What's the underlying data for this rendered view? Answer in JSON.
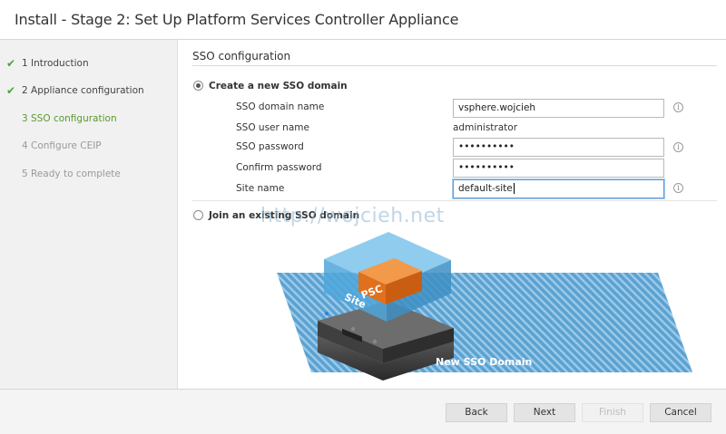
{
  "window": {
    "title": "Install - Stage 2: Set Up Platform Services Controller Appliance"
  },
  "sidebar": {
    "steps": [
      {
        "label": "1 Introduction",
        "state": "done"
      },
      {
        "label": "2 Appliance configuration",
        "state": "done"
      },
      {
        "label": "3 SSO configuration",
        "state": "current"
      },
      {
        "label": "4 Configure CEIP",
        "state": "disabled"
      },
      {
        "label": "5 Ready to complete",
        "state": "disabled"
      }
    ],
    "check_glyph": "✔"
  },
  "main": {
    "section_title": "SSO configuration",
    "options": {
      "create_label": "Create a new SSO domain",
      "join_label": "Join an existing SSO domain"
    },
    "form": {
      "domain_name_label": "SSO domain name",
      "domain_name_value": "vsphere.wojcieh",
      "user_name_label": "SSO user name",
      "user_name_value": "administrator",
      "password_label": "SSO password",
      "password_value": "••••••••••",
      "confirm_label": "Confirm password",
      "confirm_value": "••••••••••",
      "site_label": "Site name",
      "site_value": "default-site",
      "info_glyph": "i"
    },
    "illustration": {
      "psc_label": "PSC",
      "site_label": "Site",
      "domain_label": "New SSO Domain"
    },
    "watermark": "http://wojcieh.net"
  },
  "footer": {
    "back_label": "Back",
    "next_label": "Next",
    "finish_label": "Finish",
    "cancel_label": "Cancel"
  },
  "colors": {
    "accent_green": "#5a9a2e",
    "check_green": "#4aa33a",
    "domain_blue": "#4a95c7",
    "psc_orange": "#e8731e"
  }
}
